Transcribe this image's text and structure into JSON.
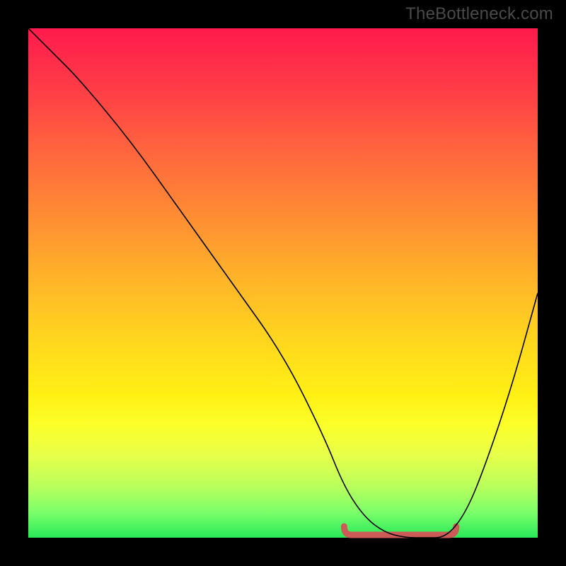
{
  "watermark": "TheBottleneck.com",
  "chart_data": {
    "type": "line",
    "title": "",
    "xlabel": "",
    "ylabel": "",
    "xlim": [
      0,
      100
    ],
    "ylim": [
      0,
      100
    ],
    "grid": false,
    "series": [
      {
        "name": "bottleneck-curve",
        "x": [
          0,
          2,
          5,
          10,
          20,
          30,
          40,
          50,
          58,
          62,
          66,
          70,
          74,
          78,
          82,
          86,
          90,
          95,
          100
        ],
        "y": [
          100,
          98,
          95,
          90,
          78,
          64,
          50,
          36,
          20,
          10,
          4,
          1,
          0,
          0,
          0,
          5,
          15,
          30,
          48
        ]
      }
    ],
    "annotation": {
      "name": "optimal-range",
      "x_range": [
        62,
        84
      ],
      "y": 0
    }
  }
}
